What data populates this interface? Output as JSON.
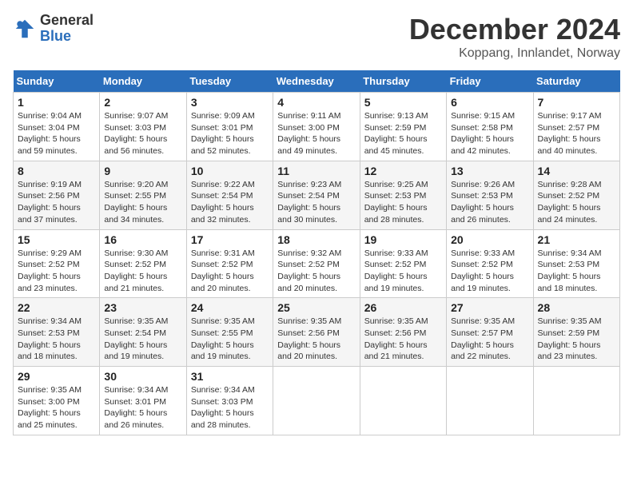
{
  "header": {
    "logo_general": "General",
    "logo_blue": "Blue",
    "month_title": "December 2024",
    "location": "Koppang, Innlandet, Norway"
  },
  "weekdays": [
    "Sunday",
    "Monday",
    "Tuesday",
    "Wednesday",
    "Thursday",
    "Friday",
    "Saturday"
  ],
  "weeks": [
    [
      {
        "day": "1",
        "sunrise": "Sunrise: 9:04 AM",
        "sunset": "Sunset: 3:04 PM",
        "daylight": "Daylight: 5 hours and 59 minutes."
      },
      {
        "day": "2",
        "sunrise": "Sunrise: 9:07 AM",
        "sunset": "Sunset: 3:03 PM",
        "daylight": "Daylight: 5 hours and 56 minutes."
      },
      {
        "day": "3",
        "sunrise": "Sunrise: 9:09 AM",
        "sunset": "Sunset: 3:01 PM",
        "daylight": "Daylight: 5 hours and 52 minutes."
      },
      {
        "day": "4",
        "sunrise": "Sunrise: 9:11 AM",
        "sunset": "Sunset: 3:00 PM",
        "daylight": "Daylight: 5 hours and 49 minutes."
      },
      {
        "day": "5",
        "sunrise": "Sunrise: 9:13 AM",
        "sunset": "Sunset: 2:59 PM",
        "daylight": "Daylight: 5 hours and 45 minutes."
      },
      {
        "day": "6",
        "sunrise": "Sunrise: 9:15 AM",
        "sunset": "Sunset: 2:58 PM",
        "daylight": "Daylight: 5 hours and 42 minutes."
      },
      {
        "day": "7",
        "sunrise": "Sunrise: 9:17 AM",
        "sunset": "Sunset: 2:57 PM",
        "daylight": "Daylight: 5 hours and 40 minutes."
      }
    ],
    [
      {
        "day": "8",
        "sunrise": "Sunrise: 9:19 AM",
        "sunset": "Sunset: 2:56 PM",
        "daylight": "Daylight: 5 hours and 37 minutes."
      },
      {
        "day": "9",
        "sunrise": "Sunrise: 9:20 AM",
        "sunset": "Sunset: 2:55 PM",
        "daylight": "Daylight: 5 hours and 34 minutes."
      },
      {
        "day": "10",
        "sunrise": "Sunrise: 9:22 AM",
        "sunset": "Sunset: 2:54 PM",
        "daylight": "Daylight: 5 hours and 32 minutes."
      },
      {
        "day": "11",
        "sunrise": "Sunrise: 9:23 AM",
        "sunset": "Sunset: 2:54 PM",
        "daylight": "Daylight: 5 hours and 30 minutes."
      },
      {
        "day": "12",
        "sunrise": "Sunrise: 9:25 AM",
        "sunset": "Sunset: 2:53 PM",
        "daylight": "Daylight: 5 hours and 28 minutes."
      },
      {
        "day": "13",
        "sunrise": "Sunrise: 9:26 AM",
        "sunset": "Sunset: 2:53 PM",
        "daylight": "Daylight: 5 hours and 26 minutes."
      },
      {
        "day": "14",
        "sunrise": "Sunrise: 9:28 AM",
        "sunset": "Sunset: 2:52 PM",
        "daylight": "Daylight: 5 hours and 24 minutes."
      }
    ],
    [
      {
        "day": "15",
        "sunrise": "Sunrise: 9:29 AM",
        "sunset": "Sunset: 2:52 PM",
        "daylight": "Daylight: 5 hours and 23 minutes."
      },
      {
        "day": "16",
        "sunrise": "Sunrise: 9:30 AM",
        "sunset": "Sunset: 2:52 PM",
        "daylight": "Daylight: 5 hours and 21 minutes."
      },
      {
        "day": "17",
        "sunrise": "Sunrise: 9:31 AM",
        "sunset": "Sunset: 2:52 PM",
        "daylight": "Daylight: 5 hours and 20 minutes."
      },
      {
        "day": "18",
        "sunrise": "Sunrise: 9:32 AM",
        "sunset": "Sunset: 2:52 PM",
        "daylight": "Daylight: 5 hours and 20 minutes."
      },
      {
        "day": "19",
        "sunrise": "Sunrise: 9:33 AM",
        "sunset": "Sunset: 2:52 PM",
        "daylight": "Daylight: 5 hours and 19 minutes."
      },
      {
        "day": "20",
        "sunrise": "Sunrise: 9:33 AM",
        "sunset": "Sunset: 2:52 PM",
        "daylight": "Daylight: 5 hours and 19 minutes."
      },
      {
        "day": "21",
        "sunrise": "Sunrise: 9:34 AM",
        "sunset": "Sunset: 2:53 PM",
        "daylight": "Daylight: 5 hours and 18 minutes."
      }
    ],
    [
      {
        "day": "22",
        "sunrise": "Sunrise: 9:34 AM",
        "sunset": "Sunset: 2:53 PM",
        "daylight": "Daylight: 5 hours and 18 minutes."
      },
      {
        "day": "23",
        "sunrise": "Sunrise: 9:35 AM",
        "sunset": "Sunset: 2:54 PM",
        "daylight": "Daylight: 5 hours and 19 minutes."
      },
      {
        "day": "24",
        "sunrise": "Sunrise: 9:35 AM",
        "sunset": "Sunset: 2:55 PM",
        "daylight": "Daylight: 5 hours and 19 minutes."
      },
      {
        "day": "25",
        "sunrise": "Sunrise: 9:35 AM",
        "sunset": "Sunset: 2:56 PM",
        "daylight": "Daylight: 5 hours and 20 minutes."
      },
      {
        "day": "26",
        "sunrise": "Sunrise: 9:35 AM",
        "sunset": "Sunset: 2:56 PM",
        "daylight": "Daylight: 5 hours and 21 minutes."
      },
      {
        "day": "27",
        "sunrise": "Sunrise: 9:35 AM",
        "sunset": "Sunset: 2:57 PM",
        "daylight": "Daylight: 5 hours and 22 minutes."
      },
      {
        "day": "28",
        "sunrise": "Sunrise: 9:35 AM",
        "sunset": "Sunset: 2:59 PM",
        "daylight": "Daylight: 5 hours and 23 minutes."
      }
    ],
    [
      {
        "day": "29",
        "sunrise": "Sunrise: 9:35 AM",
        "sunset": "Sunset: 3:00 PM",
        "daylight": "Daylight: 5 hours and 25 minutes."
      },
      {
        "day": "30",
        "sunrise": "Sunrise: 9:34 AM",
        "sunset": "Sunset: 3:01 PM",
        "daylight": "Daylight: 5 hours and 26 minutes."
      },
      {
        "day": "31",
        "sunrise": "Sunrise: 9:34 AM",
        "sunset": "Sunset: 3:03 PM",
        "daylight": "Daylight: 5 hours and 28 minutes."
      },
      null,
      null,
      null,
      null
    ]
  ]
}
